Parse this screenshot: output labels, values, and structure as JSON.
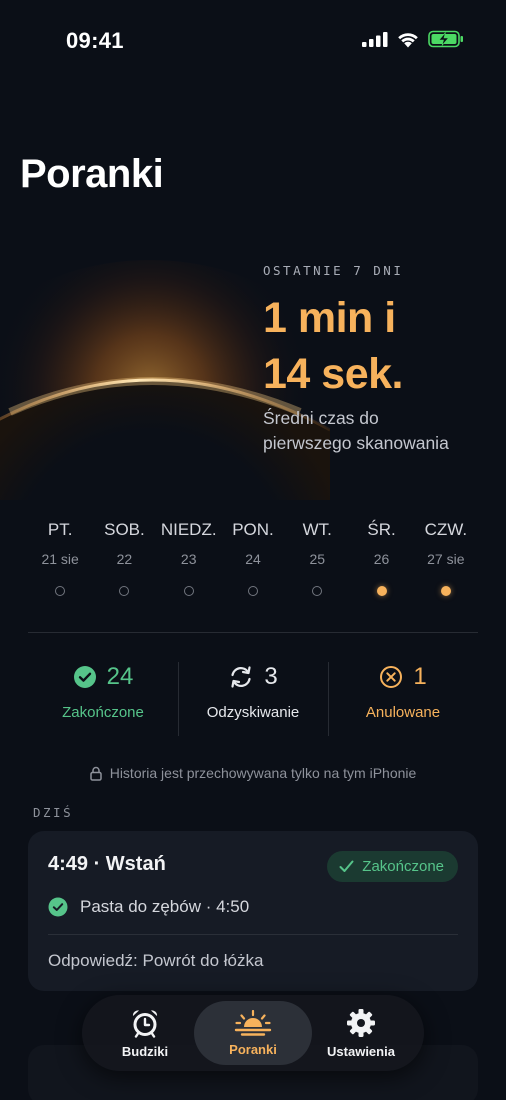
{
  "status_bar": {
    "time": "09:41"
  },
  "page": {
    "title": "Poranki"
  },
  "hero": {
    "eyebrow": "OSTATNIE 7 DNI",
    "value_line1": "1 min i",
    "value_line2": "14 sek.",
    "caption_line1": "Średni czas do",
    "caption_line2": "pierwszego skanowania"
  },
  "week": [
    {
      "name": "PT.",
      "date": "21 sie",
      "completed": false
    },
    {
      "name": "SOB.",
      "date": "22",
      "completed": false
    },
    {
      "name": "NIEDZ.",
      "date": "23",
      "completed": false
    },
    {
      "name": "PON.",
      "date": "24",
      "completed": false
    },
    {
      "name": "WT.",
      "date": "25",
      "completed": false
    },
    {
      "name": "ŚR.",
      "date": "26",
      "completed": true
    },
    {
      "name": "CZW.",
      "date": "27 sie",
      "completed": true
    }
  ],
  "summary": {
    "completed": {
      "count": "24",
      "label": "Zakończone",
      "icon": "check-circle-icon"
    },
    "recovering": {
      "count": "3",
      "label": "Odzyskiwanie",
      "icon": "sync-icon"
    },
    "cancelled": {
      "count": "1",
      "label": "Anulowane",
      "icon": "x-circle-icon"
    }
  },
  "privacy_note": "Historia jest przechowywana tylko na tym iPhonie",
  "today": {
    "section_label": "DZIŚ",
    "card": {
      "title": "4:49 · Wstań",
      "badge": "Zakończone",
      "task": "Pasta do zębów · 4:50",
      "response": "Odpowiedź: Powrót do łóżka"
    }
  },
  "tabs": [
    {
      "label": "Budziki",
      "icon": "alarm-clock-icon",
      "active": false
    },
    {
      "label": "Poranki",
      "icon": "sunrise-icon",
      "active": true
    },
    {
      "label": "Ustawienia",
      "icon": "gear-icon",
      "active": false
    }
  ],
  "colors": {
    "background": "#0b0f17",
    "accent": "#f7b25c",
    "success": "#56c48a",
    "card": "#161b25"
  }
}
